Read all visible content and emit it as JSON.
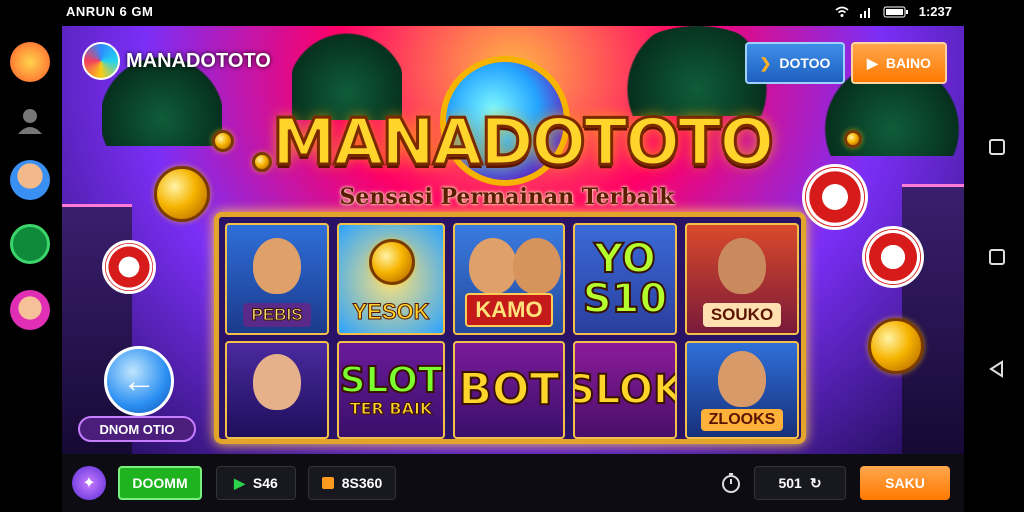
{
  "status_bar": {
    "left_text": "ANRUN 6 GM",
    "time": "1:237"
  },
  "brand": {
    "name": "MANADOTOTO"
  },
  "header_buttons": {
    "blue_label": "DOTOO",
    "orange_label": "BAINO"
  },
  "title": {
    "main": "MANADOTOTO",
    "subtitle": "Sensasi Permainan Terbaik"
  },
  "reels": {
    "top_labels": [
      "PEBIS",
      "YESOK",
      "KAMO",
      "YO S10",
      "SOUKO"
    ],
    "bottom_labels": [
      "SLOT",
      "TER BAIK",
      "BOT",
      "SLOK",
      "ZLOOKS"
    ]
  },
  "back_button": {
    "label": "DNOM OTIO"
  },
  "bottom_bar": {
    "green_label": "DOOMM",
    "credit_value": "S46",
    "balance_value": "8S360",
    "counter_value": "501",
    "orange_label": "SAKU"
  },
  "colors": {
    "accent_green": "#1fb31f",
    "accent_orange": "#ff7a00",
    "accent_blue": "#1f5fbf"
  },
  "icons": [
    "wifi-icon",
    "signal-icon",
    "battery-icon",
    "timer-icon",
    "refresh-icon",
    "play-icon",
    "coin-icon",
    "back-arrow-icon",
    "square-nav-icon",
    "triangle-back-icon"
  ]
}
